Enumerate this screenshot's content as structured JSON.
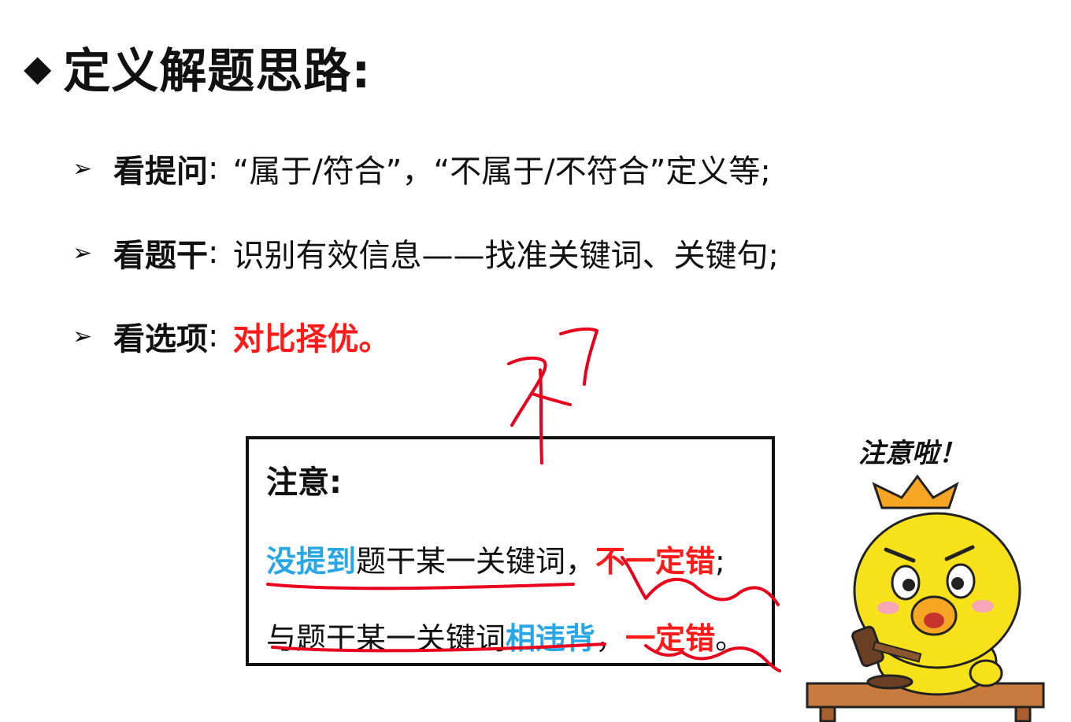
{
  "title": {
    "text": "定义解题思路:"
  },
  "points": [
    {
      "label": "看提问",
      "sep": ":",
      "body": "“属于/符合”，“不属于/不符合”定义等;"
    },
    {
      "label": "看题干",
      "sep": ":",
      "body": "识别有效信息——找准关键词、关键句;"
    },
    {
      "label": "看选项",
      "sep": ":",
      "body": "对比择优。"
    }
  ],
  "note": {
    "title": "注意:",
    "line1": {
      "blue": "没提到",
      "normal": "题干某一关键词，",
      "red": "不一定错",
      "end": ";"
    },
    "line2": {
      "normal": "与题干某一关键词",
      "blue": "相违背",
      "mid": "，",
      "red": "一定错",
      "end": "。"
    }
  },
  "mascot": {
    "caption": "注意啦！"
  },
  "colors": {
    "red": "#ff1a1a",
    "blue": "#29a6e6",
    "ink": "#e8001c",
    "mascot_yellow": "#f7e11a"
  }
}
